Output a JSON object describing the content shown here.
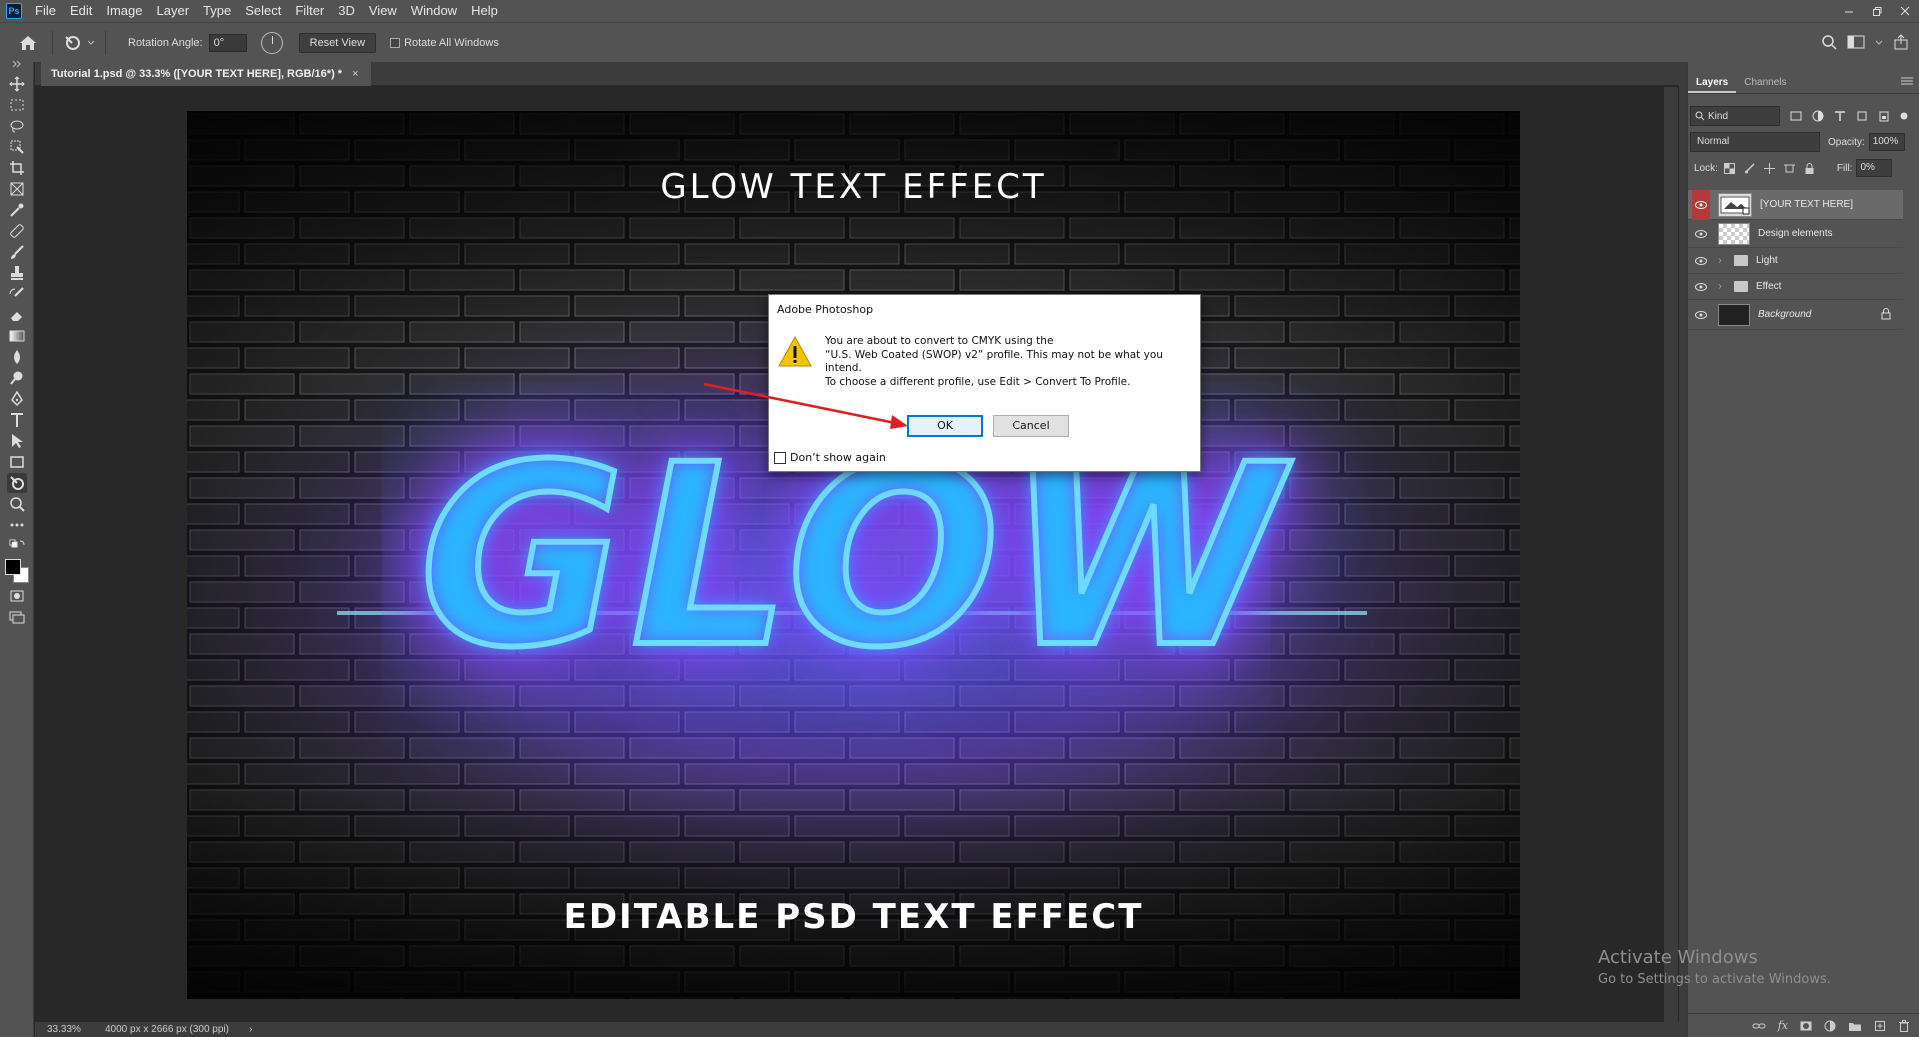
{
  "menubar": {
    "logo": "Ps",
    "items": [
      "File",
      "Edit",
      "Image",
      "Layer",
      "Type",
      "Select",
      "Filter",
      "3D",
      "View",
      "Window",
      "Help"
    ]
  },
  "options": {
    "rotation_label": "Rotation Angle:",
    "rotation_value": "0°",
    "reset_label": "Reset View",
    "rotate_all_label": "Rotate All Windows"
  },
  "document": {
    "tab_title": "Tutorial 1.psd @ 33.3% ([YOUR TEXT HERE], RGB/16*) *",
    "tab_close": "×"
  },
  "artboard": {
    "title": "GLOW TEXT EFFECT",
    "main_word": "GLOW",
    "bottom": "EDITABLE PSD TEXT EFFECT"
  },
  "dialog": {
    "title": "Adobe Photoshop",
    "message_lines": [
      "You are about to convert to CMYK using the",
      "“U.S. Web Coated (SWOP) v2” profile. This may not be what you",
      "intend.",
      "To choose a different profile, use Edit > Convert To Profile."
    ],
    "ok": "OK",
    "cancel": "Cancel",
    "dont_show": "Don’t show again"
  },
  "layers_panel": {
    "tabs": [
      "Layers",
      "Channels"
    ],
    "kind_label": "Kind",
    "blend_mode": "Normal",
    "opacity_label": "Opacity:",
    "opacity_value": "100%",
    "lock_label": "Lock:",
    "fill_label": "Fill:",
    "fill_value": "0%",
    "layers": [
      {
        "name": "[YOUR TEXT HERE]"
      },
      {
        "name": "Design elements"
      },
      {
        "name": "Light"
      },
      {
        "name": "Effect"
      },
      {
        "name": "Background"
      }
    ]
  },
  "status": {
    "zoom": "33.33%",
    "doc_info": "4000 px x 2666 px (300 ppi)",
    "arrow": "›"
  },
  "watermark": {
    "line1": "Activate Windows",
    "line2": "Go to Settings to activate Windows."
  },
  "colors": {
    "ui_bg": "#535353",
    "canvas_bg": "#282828",
    "dialog_ok_border": "#0078d7",
    "layer_eye_selected": "#b33a3a",
    "arrow": "#e02020"
  }
}
